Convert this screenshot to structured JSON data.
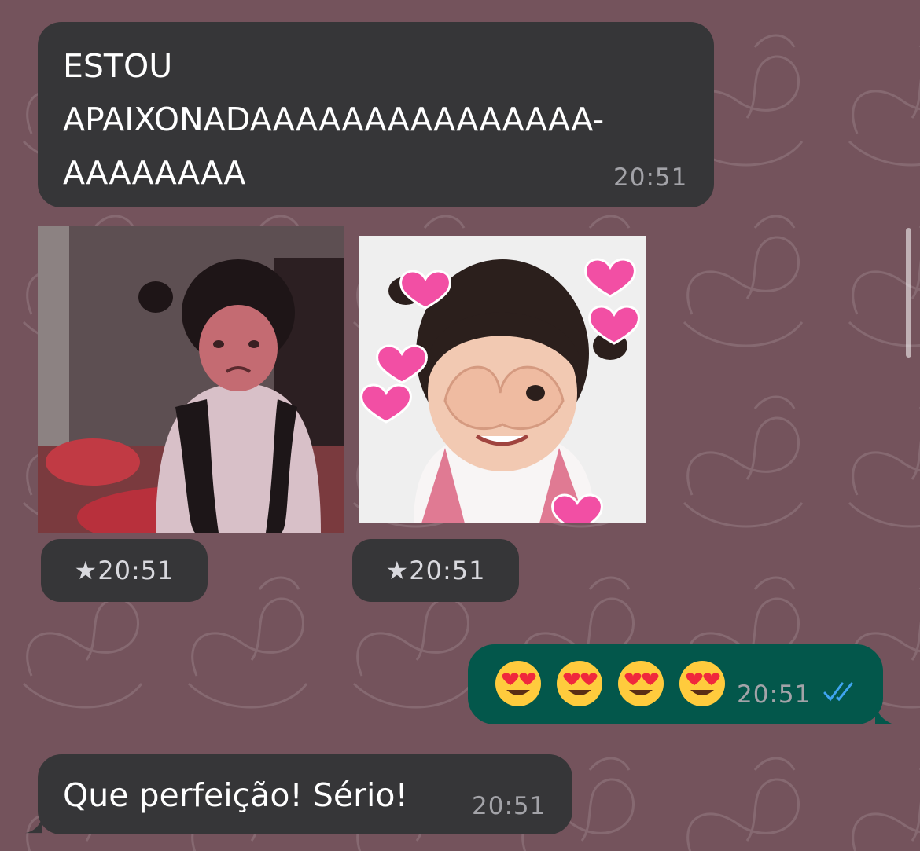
{
  "chat": {
    "messages": [
      {
        "direction": "incoming",
        "type": "text",
        "lines": [
          "ESTOU",
          "APAIXONADAAAAAAAAAAAAAAA-",
          "AAAAAAAA"
        ],
        "time": "20:51"
      },
      {
        "direction": "incoming",
        "type": "sticker",
        "subject": "crying-child-sticker",
        "starred": true,
        "time": "★20:51"
      },
      {
        "direction": "incoming",
        "type": "sticker",
        "subject": "child-heart-hands-sticker",
        "starred": true,
        "time": "★20:51"
      },
      {
        "direction": "outgoing",
        "type": "emoji",
        "emojis": [
          "heart-eyes-emoji",
          "heart-eyes-emoji",
          "heart-eyes-emoji",
          "heart-eyes-emoji"
        ],
        "time": "20:51",
        "status": "read-double-check-icon"
      },
      {
        "direction": "incoming",
        "type": "text",
        "text": "Que perfeição! Sério!",
        "time": "20:51"
      }
    ]
  },
  "colors": {
    "background": "#74535c",
    "incoming_bubble": "#363638",
    "outgoing_bubble": "#03574b",
    "read_check": "#3fa5f0",
    "timestamp": "#a3a3a8"
  }
}
